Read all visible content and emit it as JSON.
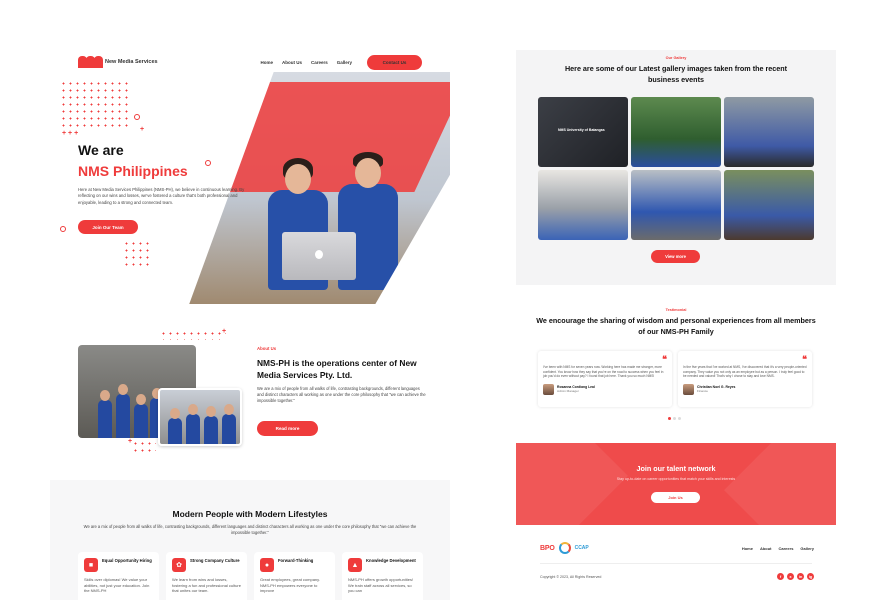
{
  "nav": {
    "brand": "New Media Services",
    "links": [
      "Home",
      "About Us",
      "Careers",
      "Gallery"
    ],
    "contact_label": "Contact Us"
  },
  "hero": {
    "title": "We are",
    "subtitle": "NMS Philippines",
    "description": "Here at New Media Services Philippines (NMS-PH), we believe in continuous learning. By reflecting on our wins and losses, we've fostered a culture that's both professional and enjoyable, leading to a strong and connected team.",
    "cta": "Join Our Team"
  },
  "about": {
    "tag": "About Us",
    "title": "NMS-PH is the operations center of New Media Services Pty. Ltd.",
    "description": "We are a mix of people from all walks of life, contrasting backgrounds, different languages and distinct characters all working as one under the core philosophy that \"we can achieve the impossible together.\"",
    "cta": "Read more"
  },
  "modern": {
    "title": "Modern People with Modern Lifestyles",
    "description": "We are a mix of people from all walks of life, contrasting backgrounds, different languages and distinct characters all working as one under the core philosophy that \"we can achieve the impossible together.\"",
    "cards": [
      {
        "title": "Equal Opportunity Hiring",
        "desc": "Skills over diplomas! We value your abilities, not just your education. Join the NMS-PH"
      },
      {
        "title": "Strong Company Culture",
        "desc": "We learn from wins and losses, fostering a fun and professional culture that unites our team."
      },
      {
        "title": "Forward-Thinking",
        "desc": "Great employees, great company. NMS-PH empowers everyone to improve"
      },
      {
        "title": "Knowledge Development",
        "desc": "NMS-PH offers growth opportunities! We train staff across all services, so you can"
      }
    ]
  },
  "gallery": {
    "tag": "Our Gallery",
    "title": "Here are some of our Latest gallery images taken from the recent business events",
    "first_caption": "NMS University of Batangas",
    "cta": "View more"
  },
  "testimonial": {
    "tag": "Testimonial",
    "title": "We encourage the sharing of wisdom and personal experiences from all members of our NMS-PH Family",
    "items": [
      {
        "text": "I've been with NMS for seven years now. Working here has made me stronger, more confident. You know how they say that you're on the road to success when you feel in job you'd do even without pay? I found that job here. Thank you so much NMS!",
        "name": "Rosanna Cordiang Leal",
        "role": "Admin Manager"
      },
      {
        "text": "In the five years that I've worked at NMS, I've discovered that it's a very people-oriented company. They value you not only as an employee but as a person. I truly feel good to be needed and valued! That's why I chose to stay and love NMS.",
        "name": "Christian Noel G. Reyes",
        "role": "Finance"
      }
    ]
  },
  "talent": {
    "title": "Join our talent network",
    "description": "Stay up-to-date on career opportunities that match your skills and interests",
    "cta": "Join Us"
  },
  "footer": {
    "bpo_logo": "BPO",
    "ccap_logo": "CCAP",
    "links": [
      "Home",
      "About",
      "Careers",
      "Gallery"
    ],
    "copyright": "Copyright © 2023, All Rights Reserved",
    "socials": [
      "f",
      "x",
      "in",
      "ig"
    ]
  },
  "colors": {
    "accent": "#ef3b3b",
    "bg_soft": "#f7f7f8"
  },
  "icons": [
    "briefcase-icon",
    "paw-icon",
    "brain-icon",
    "graduation-icon",
    "quote-icon"
  ]
}
